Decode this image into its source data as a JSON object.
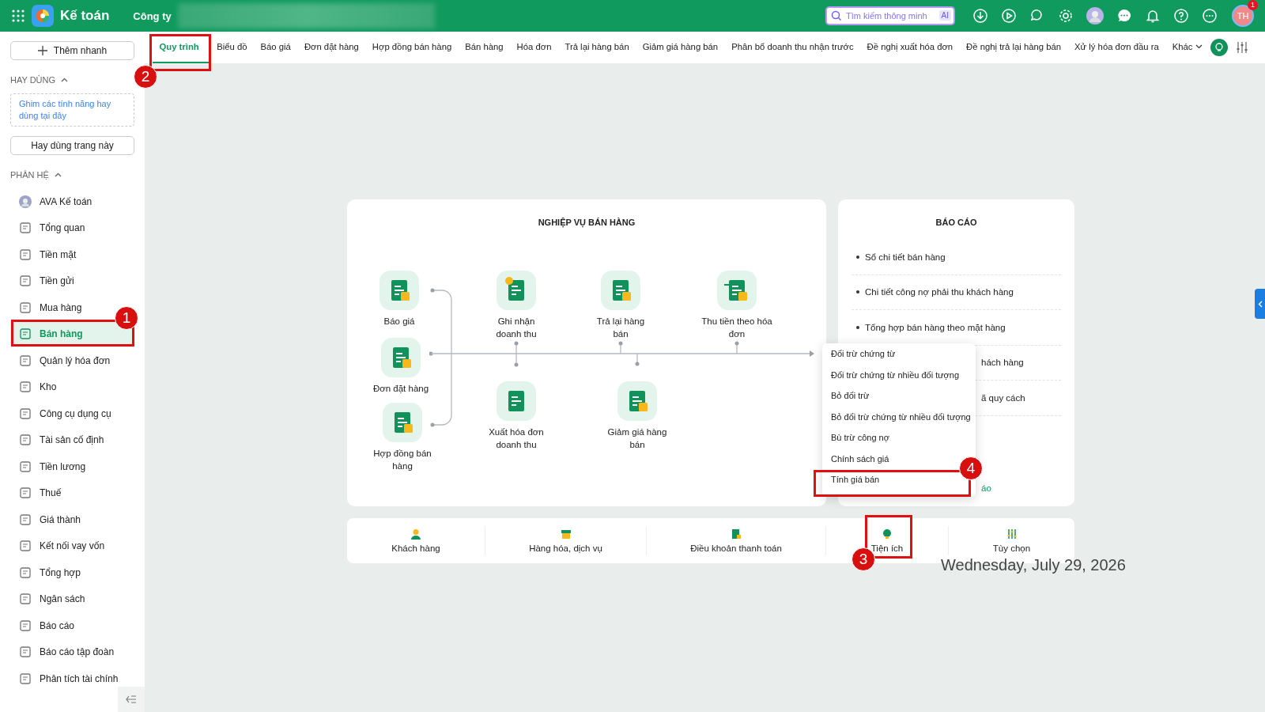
{
  "app": {
    "title": "Kế toán",
    "company": "Công ty"
  },
  "search": {
    "placeholder": "Tìm kiếm thông minh",
    "badge": "AI"
  },
  "user": {
    "initials": "TH",
    "badge": "1"
  },
  "sidebar": {
    "quick_add": "Thêm nhanh",
    "favorites": {
      "title": "HAY DÙNG",
      "expanded": true,
      "hint": "Ghim các tính năng hay dùng tại đây",
      "button": "Hay dùng trang này"
    },
    "modules": {
      "title": "PHÂN HỆ",
      "expanded": true,
      "items": [
        {
          "label": "AVA Kế toán",
          "selected": false
        },
        {
          "label": "Tổng quan",
          "selected": false
        },
        {
          "label": "Tiền mặt",
          "selected": false
        },
        {
          "label": "Tiền gửi",
          "selected": false
        },
        {
          "label": "Mua hàng",
          "selected": false
        },
        {
          "label": "Bán hàng",
          "selected": true
        },
        {
          "label": "Quản lý hóa đơn",
          "selected": false
        },
        {
          "label": "Kho",
          "selected": false
        },
        {
          "label": "Công cụ dụng cụ",
          "selected": false
        },
        {
          "label": "Tài sản cố định",
          "selected": false
        },
        {
          "label": "Tiền lương",
          "selected": false
        },
        {
          "label": "Thuế",
          "selected": false
        },
        {
          "label": "Giá thành",
          "selected": false
        },
        {
          "label": "Kết nối vay vốn",
          "selected": false
        },
        {
          "label": "Tổng hợp",
          "selected": false
        },
        {
          "label": "Ngân sách",
          "selected": false
        },
        {
          "label": "Báo cáo",
          "selected": false
        },
        {
          "label": "Báo cáo tập đoàn",
          "selected": false
        },
        {
          "label": "Phân tích tài chính",
          "selected": false
        }
      ]
    }
  },
  "tabs": [
    {
      "label": "Quy trình",
      "selected": true
    },
    {
      "label": "Biểu đồ",
      "selected": false
    },
    {
      "label": "Báo giá",
      "selected": false
    },
    {
      "label": "Đơn đặt hàng",
      "selected": false
    },
    {
      "label": "Hợp đồng bán hàng",
      "selected": false
    },
    {
      "label": "Bán hàng",
      "selected": false
    },
    {
      "label": "Hóa đơn",
      "selected": false
    },
    {
      "label": "Trả lại hàng bán",
      "selected": false
    },
    {
      "label": "Giảm giá hàng bán",
      "selected": false
    },
    {
      "label": "Phân bổ doanh thu nhận trước",
      "selected": false
    },
    {
      "label": "Đề nghị xuất hóa đơn",
      "selected": false
    },
    {
      "label": "Đề nghị trả lại hàng bán",
      "selected": false
    },
    {
      "label": "Xử lý hóa đơn đầu ra",
      "selected": false
    }
  ],
  "more_tab": "Khác",
  "process": {
    "title": "NGHIỆP VỤ BÁN HÀNG",
    "nodes": [
      {
        "label": "Báo giá"
      },
      {
        "label": "Đơn đặt hàng"
      },
      {
        "label": "Hợp đồng bán hàng"
      },
      {
        "label": "Ghi nhận doanh thu"
      },
      {
        "label": "Trả lại hàng bán"
      },
      {
        "label": "Thu tiền theo hóa đơn"
      },
      {
        "label": "Xuất hóa đơn doanh thu"
      },
      {
        "label": "Giảm giá hàng bán"
      }
    ]
  },
  "reports": {
    "title": "BÁO CÁO",
    "items": [
      {
        "text": "Sổ chi tiết bán hàng",
        "kind": "full"
      },
      {
        "text": "Chi tiết công nợ phải thu khách hàng",
        "kind": "full"
      },
      {
        "text": "Tổng hợp bán hàng theo mặt hàng",
        "kind": "full"
      },
      {
        "text": "hách hàng",
        "kind": "partial"
      },
      {
        "text": "ã quy cách",
        "kind": "partial"
      }
    ],
    "link": "áo"
  },
  "menu": {
    "items": [
      "Đối trừ chứng từ",
      "Đối trừ chứng từ nhiều đối tượng",
      "Bỏ đối trừ",
      "Bỏ đối trừ chứng từ nhiều đối tượng",
      "Bù trừ công nợ",
      "Chính sách giá",
      "Tính giá bán"
    ]
  },
  "bottom_bar": [
    {
      "label": "Khách hàng"
    },
    {
      "label": "Hàng hóa, dịch vụ"
    },
    {
      "label": "Điều khoản thanh toán"
    },
    {
      "label": "Tiện ích"
    },
    {
      "label": "Tùy chọn"
    }
  ],
  "annotations": [
    {
      "number": "1"
    },
    {
      "number": "2"
    },
    {
      "number": "3"
    },
    {
      "number": "4"
    }
  ],
  "date": "Wednesday, July 29, 2026"
}
